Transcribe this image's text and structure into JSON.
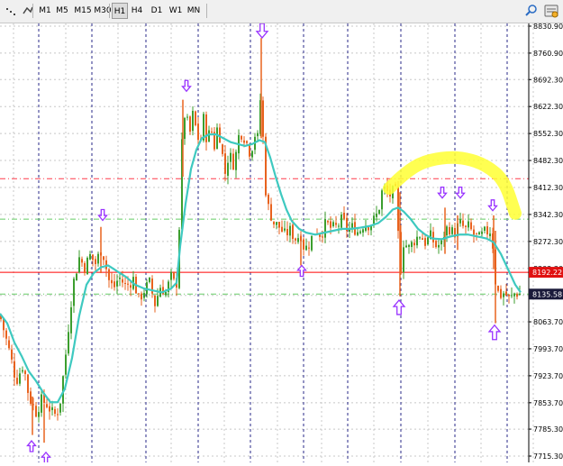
{
  "toolbar": {
    "timeframes": [
      "M1",
      "M5",
      "M15",
      "M30",
      "H1",
      "H4",
      "D1",
      "W1",
      "MN"
    ],
    "active_timeframe": "H1",
    "search_icon": "search-icon",
    "settings_icon": "settings-icon",
    "menu_icon": "menu-icon",
    "trendline_icon": "trendline-tool-icon"
  },
  "colors": {
    "bull": "#3c9e2e",
    "bear": "#e8621e",
    "ma": "#3ec9c0",
    "highlight": "#ffff33",
    "arrow": "#9933ff",
    "resistance": "#ff3b4a",
    "price_line": "#ff0000",
    "support": "#66cc66",
    "grid": "#c8c8c8",
    "vline": "#2a2a8a",
    "price_label_bg": "#e01010",
    "bid_label_bg": "#1a1a3a"
  },
  "chart_data": {
    "type": "candlestick",
    "symbol_hint": "",
    "ylim": [
      7680,
      8868
    ],
    "y_ticks": [
      8830.9,
      8760.9,
      8692.3,
      8622.3,
      8552.3,
      8482.3,
      8412.3,
      8342.3,
      8272.3,
      8202.3,
      8132.3,
      8063.7,
      7993.7,
      7923.7,
      7853.7,
      7785.3,
      7715.3
    ],
    "y_tick_labels": [
      "8830.90",
      "8760.90",
      "8692.30",
      "8622.30",
      "8552.30",
      "8482.30",
      "8412.30",
      "8342.30",
      "8272.30",
      "8202.30",
      "8132.30",
      "8063.70",
      "7993.70",
      "7923.70",
      "7853.70",
      "7785.30",
      "7715.30"
    ],
    "horizontal_lines": [
      {
        "style": "dash-dot",
        "color": "resistance",
        "price": 8435
      },
      {
        "style": "dash-dot",
        "color": "support",
        "price": 8330
      },
      {
        "style": "solid",
        "color": "price_line",
        "price": 8192.22
      },
      {
        "style": "dash-dot",
        "color": "support",
        "price": 8135.58
      }
    ],
    "price_labels": [
      {
        "price": 8192.22,
        "text": "8192.22",
        "color": "price_label_bg"
      },
      {
        "price": 8135.58,
        "text": "8135.58",
        "color": "bid_label_bg"
      }
    ],
    "close_path": [
      [
        0,
        8080
      ],
      [
        10,
        7990
      ],
      [
        18,
        7910
      ],
      [
        26,
        7955
      ],
      [
        32,
        7870
      ],
      [
        40,
        7830
      ],
      [
        46,
        7860
      ],
      [
        52,
        7850
      ],
      [
        60,
        7820
      ],
      [
        66,
        7840
      ],
      [
        70,
        7920
      ],
      [
        74,
        8000
      ],
      [
        78,
        8100
      ],
      [
        82,
        8170
      ],
      [
        88,
        8230
      ],
      [
        94,
        8205
      ],
      [
        100,
        8235
      ],
      [
        106,
        8215
      ],
      [
        112,
        8250
      ],
      [
        116,
        8230
      ],
      [
        120,
        8175
      ],
      [
        126,
        8150
      ],
      [
        132,
        8180
      ],
      [
        140,
        8155
      ],
      [
        148,
        8175
      ],
      [
        154,
        8120
      ],
      [
        160,
        8145
      ],
      [
        166,
        8165
      ],
      [
        172,
        8110
      ],
      [
        178,
        8155
      ],
      [
        184,
        8140
      ],
      [
        190,
        8180
      ],
      [
        194,
        8160
      ],
      [
        198,
        8170
      ],
      [
        200,
        8450
      ],
      [
        203,
        8560
      ],
      [
        206,
        8620
      ],
      [
        210,
        8540
      ],
      [
        214,
        8600
      ],
      [
        218,
        8560
      ],
      [
        222,
        8520
      ],
      [
        226,
        8590
      ],
      [
        230,
        8530
      ],
      [
        234,
        8570
      ],
      [
        238,
        8520
      ],
      [
        242,
        8580
      ],
      [
        246,
        8510
      ],
      [
        250,
        8450
      ],
      [
        254,
        8500
      ],
      [
        260,
        8470
      ],
      [
        266,
        8560
      ],
      [
        272,
        8540
      ],
      [
        278,
        8500
      ],
      [
        284,
        8560
      ],
      [
        288,
        8520
      ],
      [
        290,
        8760
      ],
      [
        292,
        8540
      ],
      [
        294,
        8420
      ],
      [
        298,
        8360
      ],
      [
        304,
        8320
      ],
      [
        310,
        8310
      ],
      [
        316,
        8290
      ],
      [
        322,
        8300
      ],
      [
        328,
        8280
      ],
      [
        334,
        8290
      ],
      [
        338,
        8250
      ],
      [
        344,
        8270
      ],
      [
        350,
        8305
      ],
      [
        356,
        8290
      ],
      [
        362,
        8320
      ],
      [
        368,
        8305
      ],
      [
        374,
        8310
      ],
      [
        380,
        8330
      ],
      [
        386,
        8300
      ],
      [
        392,
        8310
      ],
      [
        398,
        8295
      ],
      [
        404,
        8320
      ],
      [
        410,
        8315
      ],
      [
        416,
        8330
      ],
      [
        420,
        8350
      ],
      [
        424,
        8400
      ],
      [
        428,
        8410
      ],
      [
        432,
        8390
      ],
      [
        436,
        8400
      ],
      [
        440,
        8400
      ],
      [
        442,
        8290
      ],
      [
        444,
        8180
      ],
      [
        448,
        8270
      ],
      [
        454,
        8255
      ],
      [
        460,
        8275
      ],
      [
        466,
        8290
      ],
      [
        472,
        8270
      ],
      [
        478,
        8285
      ],
      [
        484,
        8260
      ],
      [
        490,
        8265
      ],
      [
        494,
        8300
      ],
      [
        498,
        8310
      ],
      [
        504,
        8290
      ],
      [
        508,
        8310
      ],
      [
        512,
        8320
      ],
      [
        516,
        8300
      ],
      [
        520,
        8310
      ],
      [
        526,
        8290
      ],
      [
        532,
        8280
      ],
      [
        538,
        8295
      ],
      [
        544,
        8300
      ],
      [
        548,
        8250
      ],
      [
        550,
        8170
      ],
      [
        554,
        8130
      ],
      [
        560,
        8140
      ],
      [
        566,
        8120
      ],
      [
        572,
        8140
      ],
      [
        578,
        8135
      ]
    ],
    "ma_path": [
      [
        0,
        8085
      ],
      [
        8,
        8060
      ],
      [
        16,
        8010
      ],
      [
        24,
        7975
      ],
      [
        32,
        7935
      ],
      [
        40,
        7910
      ],
      [
        48,
        7880
      ],
      [
        56,
        7855
      ],
      [
        64,
        7855
      ],
      [
        72,
        7890
      ],
      [
        80,
        7970
      ],
      [
        88,
        8080
      ],
      [
        96,
        8160
      ],
      [
        104,
        8190
      ],
      [
        112,
        8205
      ],
      [
        120,
        8210
      ],
      [
        130,
        8195
      ],
      [
        140,
        8180
      ],
      [
        150,
        8160
      ],
      [
        160,
        8150
      ],
      [
        170,
        8145
      ],
      [
        180,
        8140
      ],
      [
        190,
        8150
      ],
      [
        196,
        8165
      ],
      [
        200,
        8260
      ],
      [
        206,
        8370
      ],
      [
        212,
        8460
      ],
      [
        218,
        8510
      ],
      [
        224,
        8540
      ],
      [
        232,
        8550
      ],
      [
        240,
        8550
      ],
      [
        248,
        8540
      ],
      [
        256,
        8530
      ],
      [
        264,
        8525
      ],
      [
        272,
        8520
      ],
      [
        280,
        8525
      ],
      [
        288,
        8535
      ],
      [
        294,
        8530
      ],
      [
        300,
        8490
      ],
      [
        306,
        8440
      ],
      [
        312,
        8395
      ],
      [
        318,
        8355
      ],
      [
        324,
        8325
      ],
      [
        332,
        8305
      ],
      [
        340,
        8295
      ],
      [
        350,
        8290
      ],
      [
        360,
        8295
      ],
      [
        370,
        8300
      ],
      [
        380,
        8305
      ],
      [
        390,
        8305
      ],
      [
        400,
        8308
      ],
      [
        410,
        8312
      ],
      [
        420,
        8320
      ],
      [
        428,
        8335
      ],
      [
        436,
        8355
      ],
      [
        442,
        8360
      ],
      [
        448,
        8350
      ],
      [
        456,
        8330
      ],
      [
        464,
        8305
      ],
      [
        472,
        8290
      ],
      [
        480,
        8280
      ],
      [
        490,
        8278
      ],
      [
        500,
        8285
      ],
      [
        510,
        8290
      ],
      [
        520,
        8290
      ],
      [
        530,
        8285
      ],
      [
        540,
        8280
      ],
      [
        548,
        8270
      ],
      [
        556,
        8240
      ],
      [
        564,
        8200
      ],
      [
        572,
        8160
      ],
      [
        578,
        8140
      ]
    ],
    "spikes": [
      {
        "x": 290,
        "high": 8800,
        "low": 8540
      },
      {
        "x": 203,
        "high": 8640,
        "low": 8440
      },
      {
        "x": 444,
        "high": 8400,
        "low": 8130
      },
      {
        "x": 550,
        "high": 8300,
        "low": 8060
      },
      {
        "x": 548,
        "high": 8340,
        "low": 8200
      },
      {
        "x": 494,
        "high": 8360,
        "low": 8240
      },
      {
        "x": 508,
        "high": 8340,
        "low": 8250
      },
      {
        "x": 112,
        "high": 8310,
        "low": 8190
      },
      {
        "x": 36,
        "high": 7870,
        "low": 7770
      },
      {
        "x": 49,
        "high": 7850,
        "low": 7750
      },
      {
        "x": 334,
        "high": 8290,
        "low": 8210
      }
    ],
    "arrows": [
      {
        "x": 291,
        "price": 8838,
        "dir": "down",
        "size": "lg"
      },
      {
        "x": 207,
        "price": 8690,
        "dir": "down",
        "size": "sm"
      },
      {
        "x": 114,
        "price": 8355,
        "dir": "down",
        "size": "sm"
      },
      {
        "x": 491,
        "price": 8413,
        "dir": "down",
        "size": "sm"
      },
      {
        "x": 511,
        "price": 8413,
        "dir": "down",
        "size": "sm"
      },
      {
        "x": 547,
        "price": 8380,
        "dir": "down",
        "size": "sm"
      },
      {
        "x": 335,
        "price": 8210,
        "dir": "up",
        "size": "sm"
      },
      {
        "x": 443,
        "price": 8120,
        "dir": "up",
        "size": "lg"
      },
      {
        "x": 549,
        "price": 8055,
        "dir": "up",
        "size": "lg"
      },
      {
        "x": 35,
        "price": 7755,
        "dir": "up",
        "size": "sm"
      },
      {
        "x": 51,
        "price": 7725,
        "dir": "up",
        "size": "sm"
      }
    ],
    "highlight_arc": [
      [
        432,
        8410
      ],
      [
        445,
        8440
      ],
      [
        465,
        8475
      ],
      [
        490,
        8490
      ],
      [
        515,
        8490
      ],
      [
        540,
        8470
      ],
      [
        560,
        8430
      ],
      [
        572,
        8345
      ]
    ],
    "vertical_separators_x": [
      43,
      102,
      162,
      220,
      278,
      337,
      386,
      445,
      505,
      563
    ],
    "vertical_grid_x": [
      15,
      73,
      131,
      190,
      249,
      308,
      357,
      415,
      475,
      534,
      592
    ]
  }
}
